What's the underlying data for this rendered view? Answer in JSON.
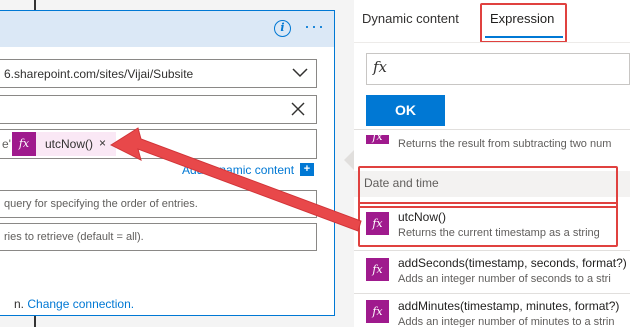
{
  "action_card": {
    "site_address": "6.sharepoint.com/sites/Vijai/Subsite",
    "list_name": "",
    "filter_query": {
      "leading_text": "e'",
      "token": {
        "icon": "fx-icon",
        "label": "utcNow()"
      }
    },
    "add_dynamic_content": "Add dynamic content",
    "order_by_placeholder": "query for specifying the order of entries.",
    "top_count_placeholder": "ries to retrieve (default = all).",
    "footer": {
      "prefix": "n.",
      "change_connection": "Change connection."
    }
  },
  "panel": {
    "tabs": [
      {
        "label": "Dynamic content",
        "active": false
      },
      {
        "label": "Expression",
        "active": true
      }
    ],
    "expression_input": {
      "icon": "fx-icon",
      "value": ""
    },
    "ok_label": "OK",
    "prev_item_desc": "Returns the result from subtracting two num",
    "section_label": "Date and time",
    "functions": [
      {
        "name": "utcNow()",
        "desc": "Returns the current timestamp as a string"
      },
      {
        "name": "addSeconds(timestamp, seconds, format?)",
        "desc": "Adds an integer number of seconds to a stri"
      },
      {
        "name": "addMinutes(timestamp, minutes, format?)",
        "desc": "Adds an integer number of minutes to a strin"
      }
    ]
  },
  "colors": {
    "accent": "#0078d4",
    "function_icon": "#9f1a8d",
    "highlight": "#e0413f",
    "header_bg": "#dbe8f6"
  }
}
